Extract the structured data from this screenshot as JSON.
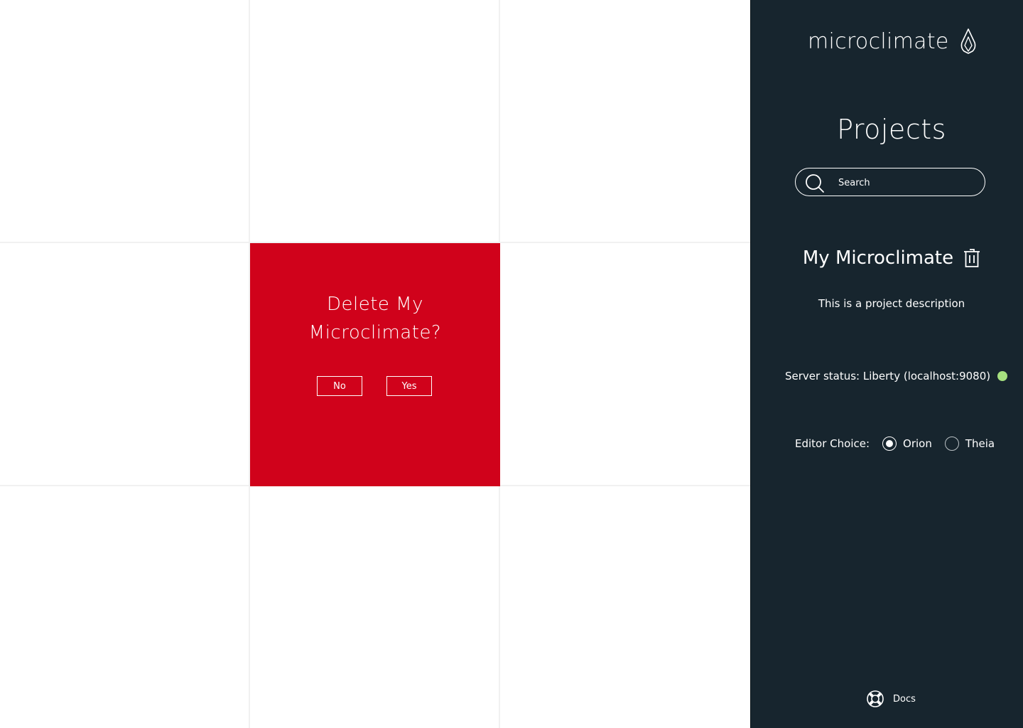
{
  "colors": {
    "accent_red": "#d0021b",
    "panel_bg": "#17252e",
    "status_ok": "#a6e07f"
  },
  "confirm": {
    "title": "Delete My Microclimate?",
    "no_label": "No",
    "yes_label": "Yes"
  },
  "sidebar": {
    "brand": "microclimate",
    "brand_icon": "microclimate-flame-logo",
    "title": "Projects",
    "search": {
      "placeholder": "Search",
      "value": ""
    },
    "project": {
      "name": "My Microclimate",
      "description": "This is a project description",
      "server_status": "Server status: Liberty (localhost:9080)",
      "server_state": "running"
    },
    "editor": {
      "label": "Editor Choice:",
      "options": [
        {
          "label": "Orion",
          "selected": true
        },
        {
          "label": "Theia",
          "selected": false
        }
      ]
    },
    "docs_label": "Docs",
    "docs_icon": "lifebuoy-icon"
  }
}
